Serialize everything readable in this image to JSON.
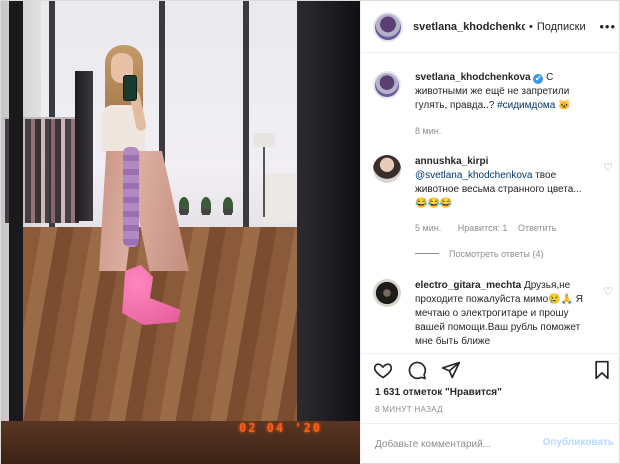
{
  "header": {
    "username": "svetlana_khodchenkova",
    "separator": "•",
    "follow_label": "Подписки",
    "more_icon": "more-horizontal-icon"
  },
  "photo": {
    "date_stamp": "02 04 '20"
  },
  "caption": {
    "username": "svetlana_khodchenkova",
    "verified_glyph": "✔",
    "text": "С животными же ещё не запретили гулять, правда..? ",
    "hashtag": "#сидимдома",
    "emoji": "🐱",
    "time": "8 мин."
  },
  "comments": [
    {
      "username": "annushka_kirpi",
      "mention": "@svetlana_khodchenkova",
      "text": " твое животное весьма странного цвета...",
      "emoji": "😂😂😂",
      "time": "5 мин.",
      "likes": "Нравится: 1",
      "reply": "Ответить",
      "view_replies": "Посмотреть ответы (4)"
    },
    {
      "username": "electro_gitara_mechta",
      "text": " Друзья,не проходите пожалуйста мимо",
      "emoji": "😢🙏",
      "text2": " Я мечтаю о электрогитаре и прошу вашей помощи.Ваш рубль поможет мне быть ближе"
    }
  ],
  "actions": {
    "like_icon": "heart-icon",
    "comment_icon": "comment-icon",
    "share_icon": "share-icon",
    "save_icon": "bookmark-icon"
  },
  "likes_text": "1 631 отметок \"Нравится\"",
  "time_ago": "8 МИНУТ НАЗАД",
  "add_comment": {
    "placeholder": "Добавьте комментарий...",
    "publish_label": "Опубликовать"
  },
  "colors": {
    "link": "#00376b",
    "verified": "#3897f0",
    "publish_disabled": "#b3dbff",
    "date_stamp": "#ff5a1f"
  }
}
